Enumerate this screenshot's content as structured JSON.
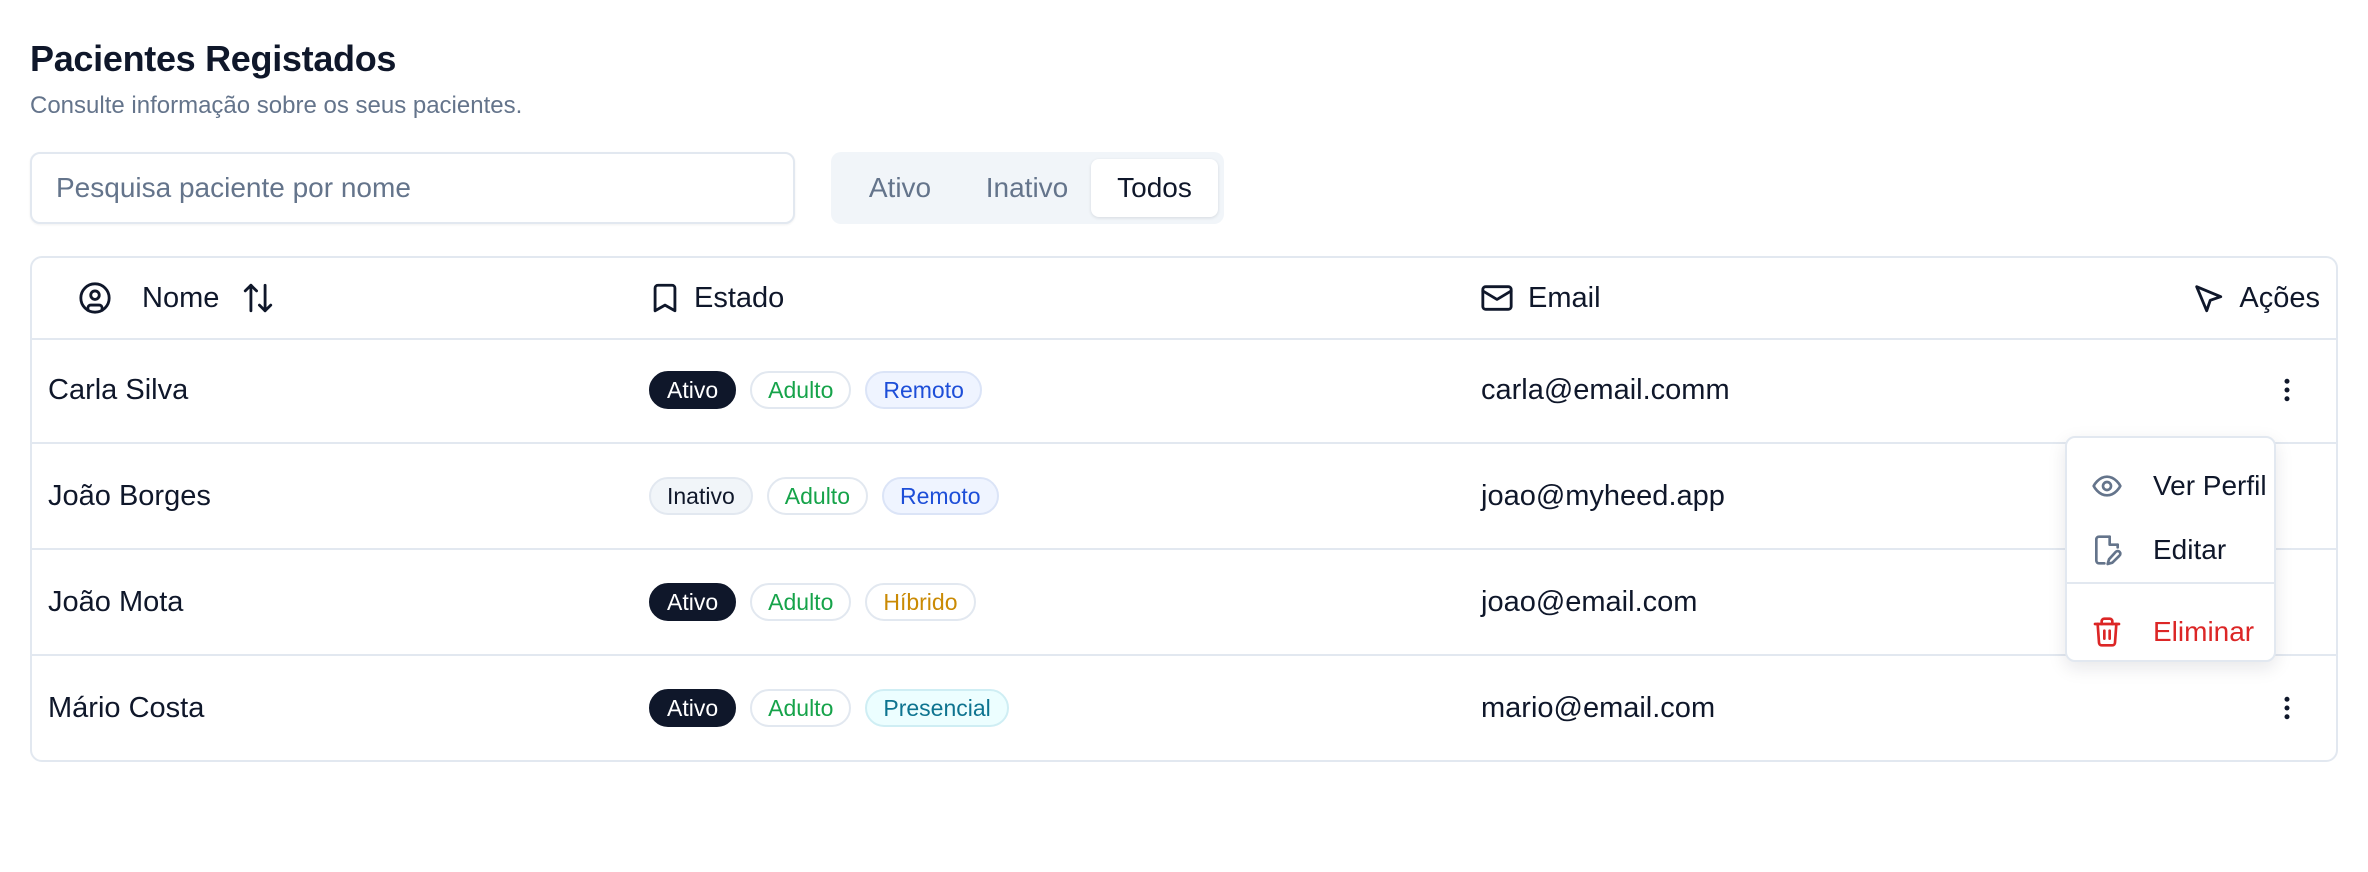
{
  "header": {
    "title": "Pacientes Registados",
    "subtitle": "Consulte informação sobre os seus pacientes."
  },
  "search": {
    "placeholder": "Pesquisa paciente por nome",
    "value": ""
  },
  "filters": {
    "selected": "Todos",
    "options": [
      "Ativo",
      "Inativo",
      "Todos"
    ]
  },
  "table": {
    "columns": {
      "name": "Nome",
      "estado": "Estado",
      "email": "Email",
      "acoes": "Ações"
    },
    "rows": [
      {
        "name": "Carla Silva",
        "badges": [
          "Ativo",
          "Adulto",
          "Remoto"
        ],
        "email": "carla@email.comm"
      },
      {
        "name": "João Borges",
        "badges": [
          "Inativo",
          "Adulto",
          "Remoto"
        ],
        "email": "joao@myheed.app"
      },
      {
        "name": "João Mota",
        "badges": [
          "Ativo",
          "Adulto",
          "Híbrido"
        ],
        "email": "joao@email.com"
      },
      {
        "name": "Mário Costa",
        "badges": [
          "Ativo",
          "Adulto",
          "Presencial"
        ],
        "email": "mario@email.com"
      }
    ]
  },
  "action_menu": {
    "open_for_row": 0,
    "items": {
      "view": "Ver Perfil",
      "edit": "Editar",
      "delete": "Eliminar"
    }
  },
  "icons": {
    "name_column": "user-circle-icon",
    "sort": "sort-arrows-icon",
    "estado_column": "bookmark-icon",
    "email_column": "mail-icon",
    "acoes_column": "pointer-icon",
    "row_actions": "more-vertical-icon",
    "view": "eye-icon",
    "edit": "file-edit-icon",
    "delete": "trash-icon"
  },
  "colors": {
    "text": "#0f172a",
    "muted": "#64748b",
    "border": "#e2e8f0",
    "badge_active_bg": "#0f172a",
    "badge_adulto": "#16a34a",
    "badge_remoto": "#1d4ed8",
    "badge_hibrido": "#ca8a04",
    "badge_presencial": "#0e7490",
    "danger": "#dc2626"
  }
}
